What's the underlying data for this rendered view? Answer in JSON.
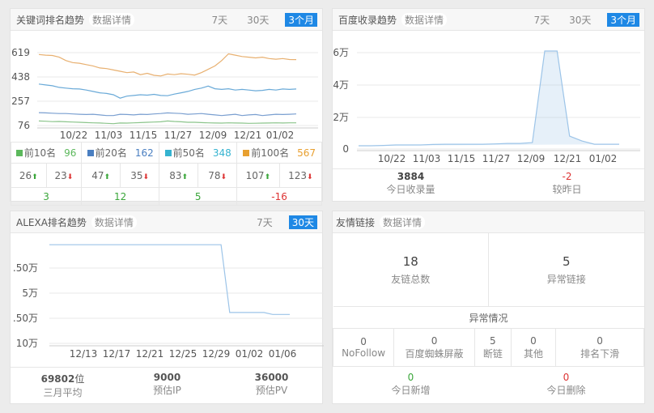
{
  "keyword": {
    "title": "关键词排名趋势",
    "detail": "数据详情",
    "tabs": [
      "7天",
      "30天",
      "3个月"
    ],
    "active": 2,
    "legend": [
      {
        "label": "前10名",
        "value": "96",
        "color": "#5cb85c",
        "up": "26",
        "down": "23",
        "diff": "3"
      },
      {
        "label": "前20名",
        "value": "162",
        "color": "#4a7fc1",
        "up": "47",
        "down": "35",
        "diff": "12"
      },
      {
        "label": "前50名",
        "value": "348",
        "color": "#35b3d0",
        "up": "83",
        "down": "78",
        "diff": "5"
      },
      {
        "label": "前100名",
        "value": "567",
        "color": "#e8a030",
        "up": "107",
        "down": "123",
        "diff": "-16"
      }
    ]
  },
  "baidu": {
    "title": "百度收录趋势",
    "detail": "数据详情",
    "tabs": [
      "7天",
      "30天",
      "3个月"
    ],
    "active": 2,
    "count": "3884",
    "count_label": "今日收录量",
    "change": "-2",
    "change_label": "较昨日"
  },
  "alexa": {
    "title": "ALEXA排名趋势",
    "detail": "数据详情",
    "tabs": [
      "7天",
      "30天"
    ],
    "active": 1,
    "avg": "69802",
    "avg_unit": "位",
    "avg_label": "三月平均",
    "ip": "9000",
    "ip_label": "预估IP",
    "pv": "36000",
    "pv_label": "预估PV"
  },
  "links": {
    "title": "友情链接",
    "detail": "数据详情",
    "total": "18",
    "total_label": "友链总数",
    "abnormal": "5",
    "abnormal_label": "异常链接",
    "section": "异常情况",
    "items": [
      {
        "v": "0",
        "l": "NoFollow"
      },
      {
        "v": "0",
        "l": "百度蜘蛛屏蔽"
      },
      {
        "v": "5",
        "l": "断链"
      },
      {
        "v": "0",
        "l": "其他"
      },
      {
        "v": "0",
        "l": "排名下滑"
      }
    ],
    "new": "0",
    "new_label": "今日新增",
    "del": "0",
    "del_label": "今日删除"
  },
  "chart_data": [
    {
      "type": "line",
      "title": "关键词排名趋势",
      "yticks": [
        "619",
        "438",
        "257",
        "76"
      ],
      "ylim": [
        76,
        619
      ],
      "xticks": [
        "10/22",
        "11/03",
        "11/15",
        "11/27",
        "12/09",
        "12/21",
        "01/02"
      ],
      "xrange_days": [
        -12,
        93
      ],
      "series": [
        {
          "name": "前100名",
          "color": "#e8b070",
          "values": [
            605,
            600,
            598,
            585,
            560,
            545,
            540,
            530,
            520,
            505,
            500,
            490,
            480,
            470,
            475,
            455,
            465,
            450,
            445,
            460,
            455,
            462,
            458,
            452,
            470,
            495,
            520,
            560,
            610,
            600,
            590,
            585,
            580,
            585,
            575,
            570,
            575,
            568,
            567
          ]
        },
        {
          "name": "前50名",
          "color": "#6aaad8",
          "values": [
            385,
            378,
            372,
            360,
            355,
            350,
            348,
            340,
            330,
            320,
            315,
            305,
            280,
            295,
            300,
            305,
            302,
            308,
            300,
            298,
            310,
            320,
            330,
            345,
            355,
            370,
            350,
            345,
            350,
            340,
            345,
            340,
            335,
            338,
            345,
            340,
            348,
            345,
            348
          ]
        },
        {
          "name": "前20名",
          "color": "#7a9fd0",
          "values": [
            172,
            170,
            168,
            165,
            165,
            162,
            160,
            158,
            160,
            155,
            150,
            150,
            160,
            158,
            155,
            160,
            158,
            162,
            165,
            170,
            168,
            165,
            160,
            162,
            165,
            160,
            155,
            150,
            155,
            160,
            150,
            155,
            158,
            150,
            155,
            160,
            158,
            160,
            162
          ]
        },
        {
          "name": "前10名",
          "color": "#8bc48b",
          "values": [
            110,
            108,
            105,
            106,
            104,
            102,
            100,
            98,
            96,
            95,
            92,
            90,
            95,
            94,
            96,
            98,
            100,
            102,
            104,
            110,
            106,
            104,
            100,
            100,
            98,
            96,
            95,
            94,
            96,
            95,
            94,
            92,
            93,
            94,
            95,
            96,
            95,
            96,
            96
          ]
        }
      ]
    },
    {
      "type": "line",
      "title": "百度收录趋势",
      "yticks": [
        "6万",
        "4万",
        "2万",
        "0"
      ],
      "ylim": [
        0,
        6
      ],
      "xticks": [
        "10/22",
        "11/03",
        "11/15",
        "11/27",
        "12/09",
        "12/21",
        "01/02"
      ],
      "series": [
        {
          "name": "收录量",
          "color": "#9cc4e8",
          "values": [
            0.2,
            0.2,
            0.22,
            0.25,
            0.25,
            0.25,
            0.28,
            0.3,
            0.3,
            0.3,
            0.3,
            0.32,
            0.35,
            0.35,
            0.4,
            6.1,
            6.1,
            0.8,
            0.5,
            0.3,
            0.3,
            0.3
          ]
        }
      ]
    },
    {
      "type": "line",
      "title": "ALEXA排名趋势",
      "yticks": [
        ".50万",
        "5万",
        ".50万",
        "10万"
      ],
      "ylim": [
        0,
        10
      ],
      "xticks": [
        "12/13",
        "12/17",
        "12/21",
        "12/25",
        "12/29",
        "01/02",
        "01/06"
      ],
      "series": [
        {
          "name": "排名",
          "color": "#9cc4e8",
          "values": [
            0.1,
            0.1,
            0.1,
            0.1,
            0.1,
            0.1,
            0.1,
            0.1,
            0.1,
            0.1,
            0.1,
            0.1,
            0.1,
            0.1,
            0.1,
            0.1,
            0.1,
            0.1,
            0.1,
            0.1,
            0.1,
            6.9,
            6.9,
            6.9,
            6.9,
            6.9,
            7.1,
            7.1,
            7.1
          ]
        }
      ]
    }
  ]
}
